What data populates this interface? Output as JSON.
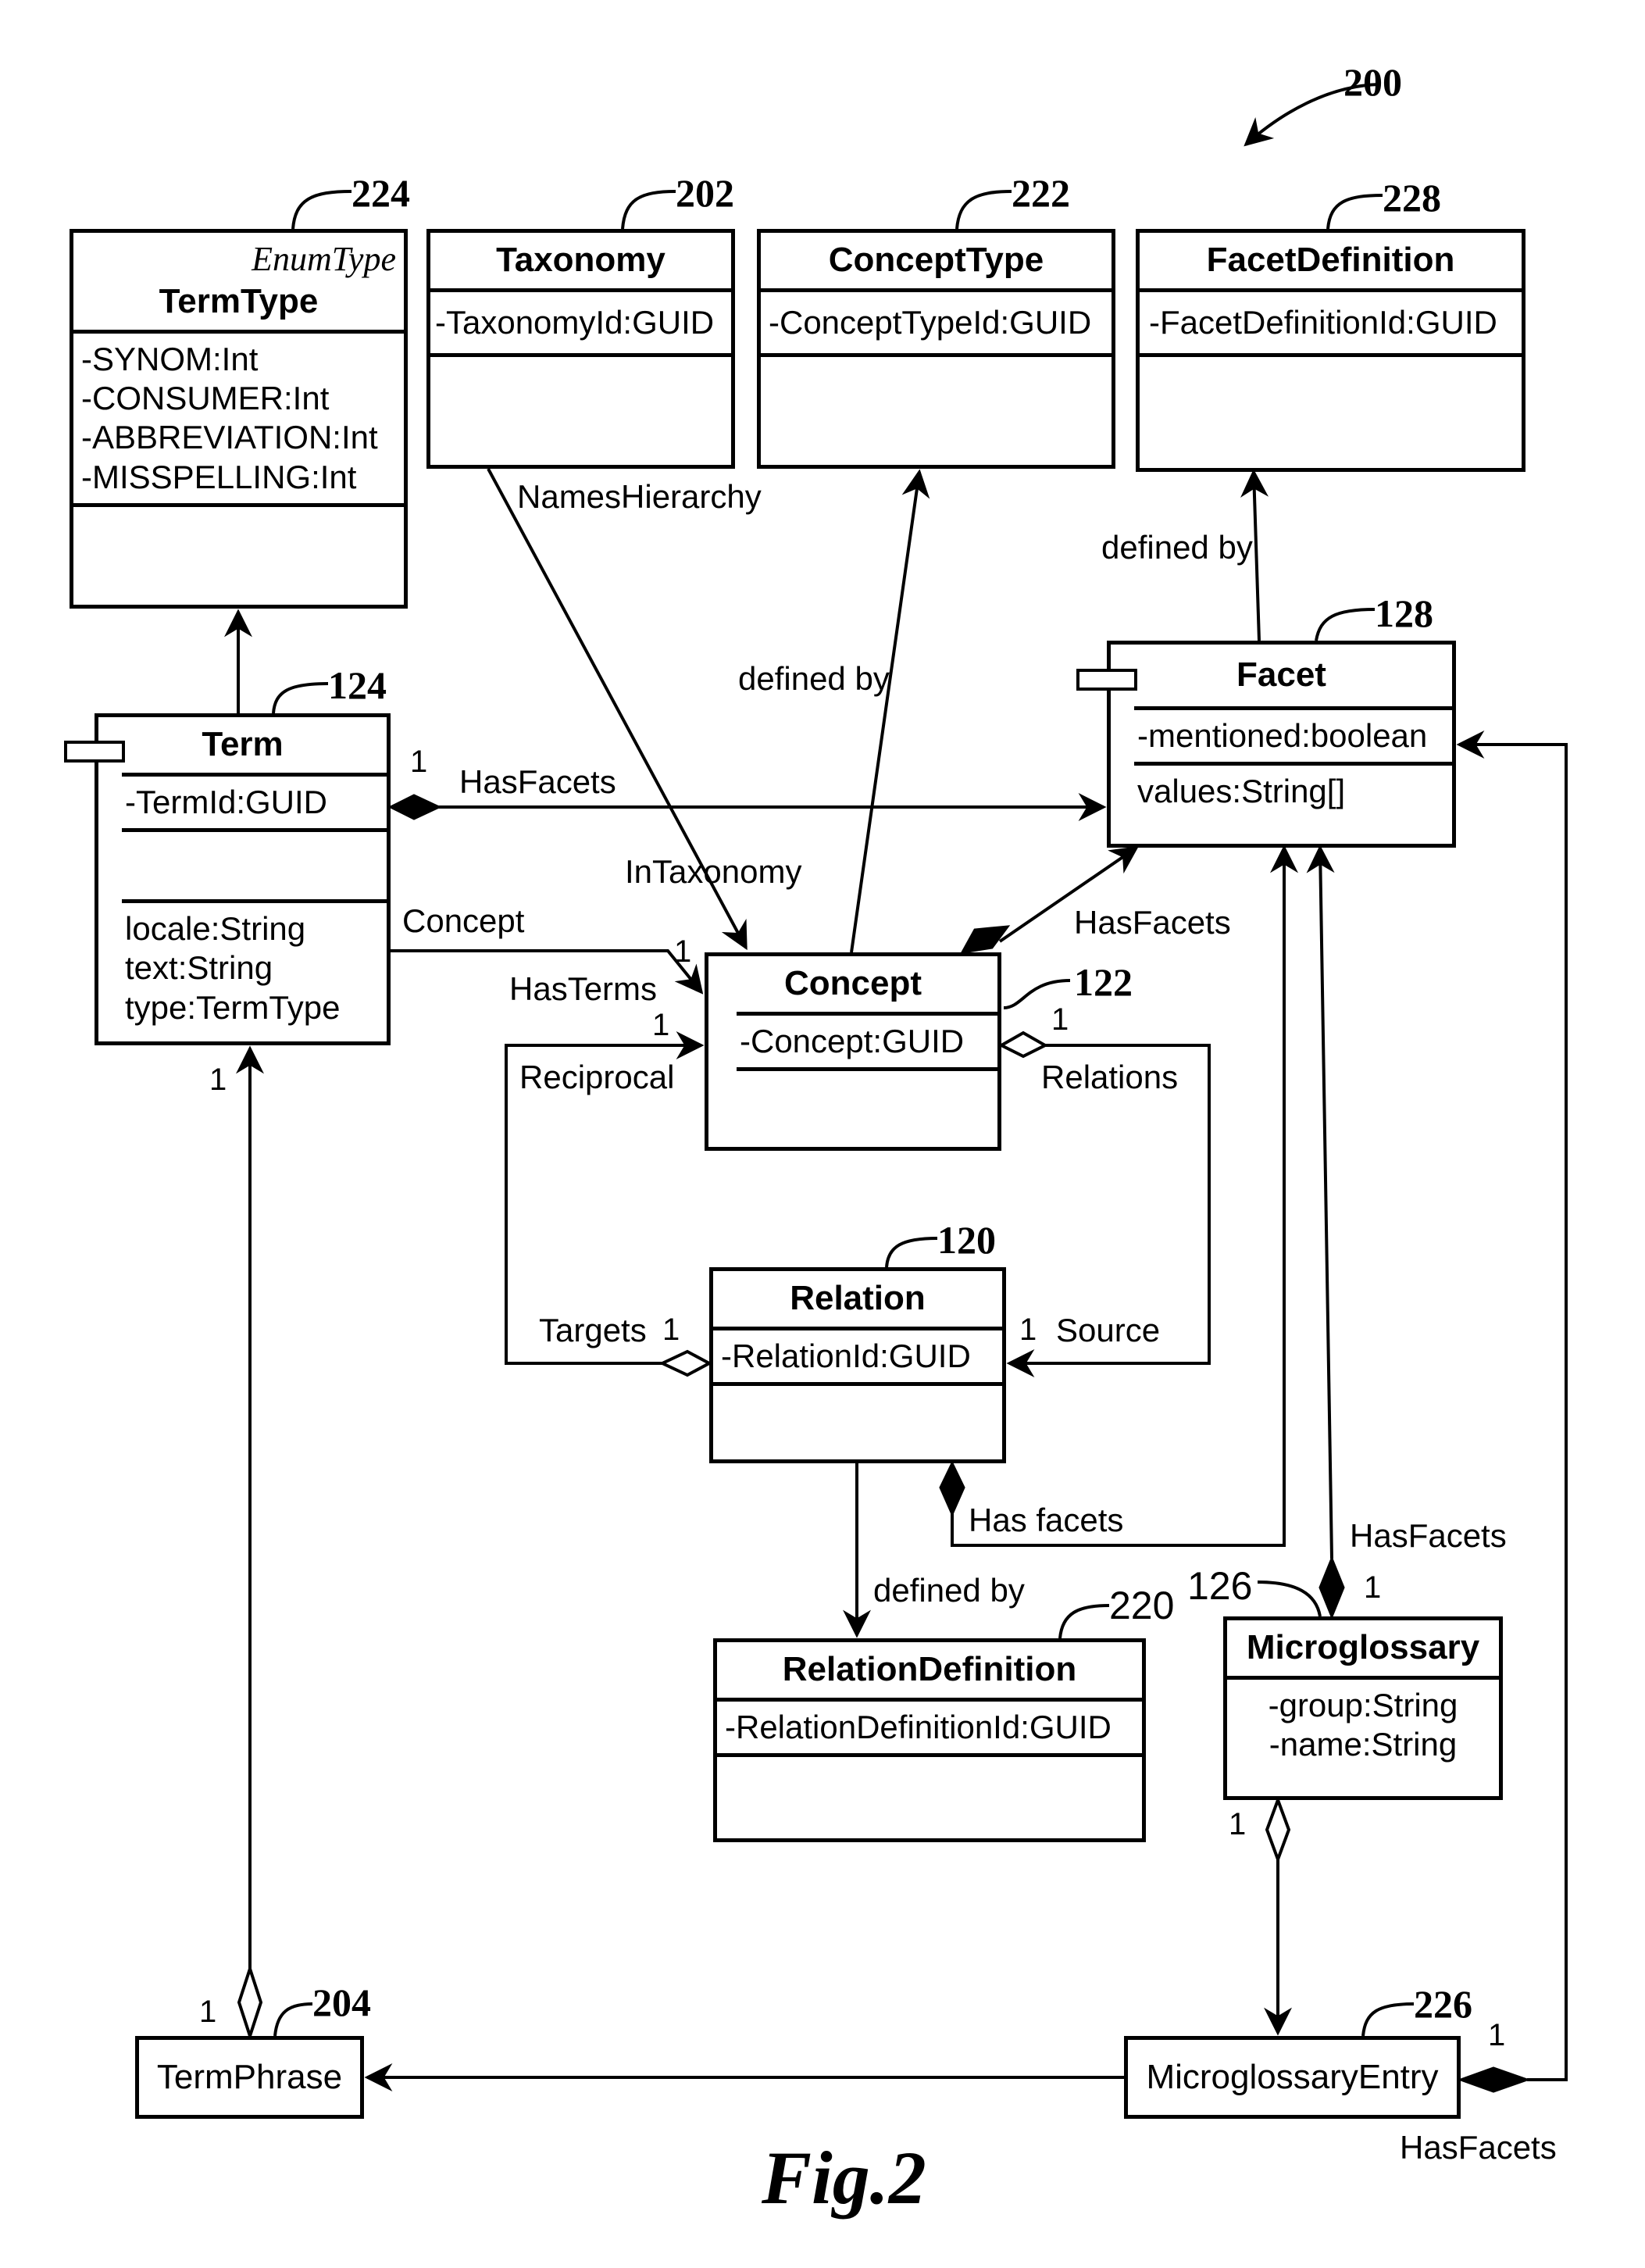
{
  "figure": {
    "caption": "Fig.2",
    "reference": "200"
  },
  "classes": {
    "termtype": {
      "ref": "224",
      "stereotype": "EnumType",
      "name": "TermType",
      "attributes": [
        "-SYNOM:Int",
        "-CONSUMER:Int",
        "-ABBREVIATION:Int",
        "-MISSPELLING:Int"
      ]
    },
    "taxonomy": {
      "ref": "202",
      "name": "Taxonomy",
      "attributes": [
        "-TaxonomyId:GUID"
      ]
    },
    "concepttype": {
      "ref": "222",
      "name": "ConceptType",
      "attributes": [
        "-ConceptTypeId:GUID"
      ]
    },
    "facetdefinition": {
      "ref": "228",
      "name": "FacetDefinition",
      "attributes": [
        "-FacetDefinitionId:GUID"
      ]
    },
    "facet": {
      "ref": "128",
      "name": "Facet",
      "attributes": [
        "-mentioned:boolean"
      ],
      "operations": [
        "values:String[]"
      ]
    },
    "term": {
      "ref": "124",
      "name": "Term",
      "attributes": [
        "-TermId:GUID"
      ],
      "operations": [
        "locale:String",
        "text:String",
        "type:TermType"
      ]
    },
    "concept": {
      "ref": "122",
      "name": "Concept",
      "attributes": [
        "-Concept:GUID"
      ]
    },
    "relation": {
      "ref": "120",
      "name": "Relation",
      "attributes": [
        "-RelationId:GUID"
      ]
    },
    "relationdefinition": {
      "ref": "220",
      "name": "RelationDefinition",
      "attributes": [
        "-RelationDefinitionId:GUID"
      ]
    },
    "microglossary": {
      "ref": "126",
      "name": "Microglossary",
      "attributes": [
        "-group:String",
        "-name:String"
      ]
    },
    "termphrase": {
      "ref": "204",
      "name": "TermPhrase"
    },
    "microglossaryentry": {
      "ref": "226",
      "name": "MicroglossaryEntry"
    }
  },
  "associations": {
    "names_hierarchy": "NamesHierarchy",
    "in_taxonomy": "InTaxonomy",
    "concept_defined_by": "defined by",
    "facet_defined_by": "defined by",
    "term_has_facets": "HasFacets",
    "concept_link": "Concept",
    "has_terms": "HasTerms",
    "concept_has_facets": "HasFacets",
    "reciprocal": "Reciprocal",
    "relations": "Relations",
    "targets": "Targets",
    "source": "Source",
    "relation_has_facets": "Has facets",
    "relation_defined_by": "defined by",
    "microglossary_has_facets": "HasFacets",
    "entry_has_facets": "HasFacets"
  },
  "multiplicities": {
    "term_hasfacets": "1",
    "concept_hasterms_top": "1",
    "concept_hasterms_bottom": "1",
    "concept_relations": "1",
    "targets": "1",
    "source": "1",
    "term_bottom": "1",
    "termphrase": "1",
    "microglossary_top": "1",
    "microglossary_bottom": "1",
    "entry": "1"
  }
}
